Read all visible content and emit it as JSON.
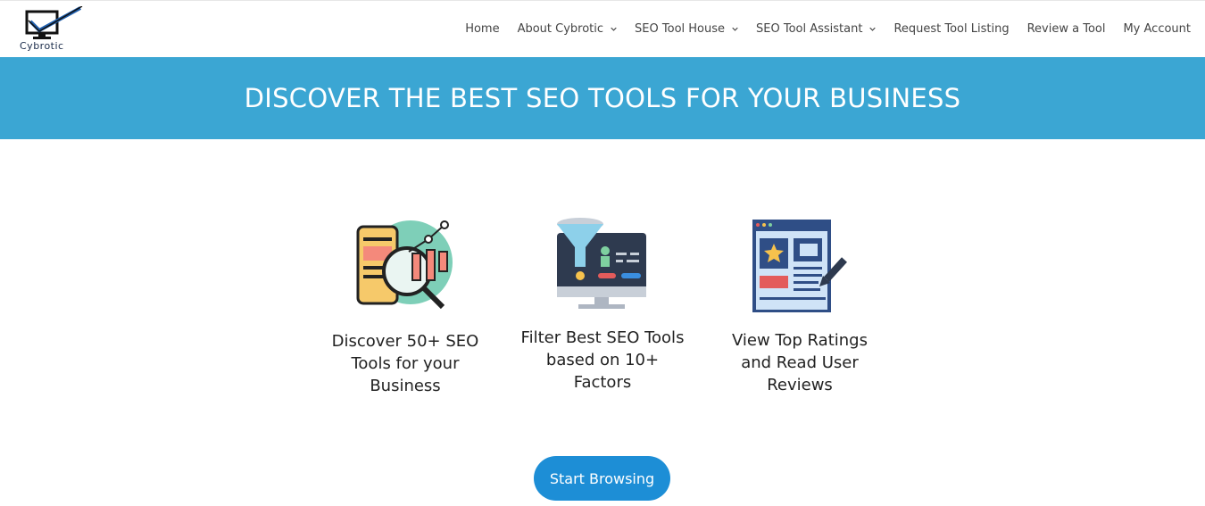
{
  "brand": {
    "logo_text": "Cybrotic"
  },
  "nav": {
    "items": [
      {
        "label": "Home",
        "has_dropdown": false
      },
      {
        "label": "About Cybrotic",
        "has_dropdown": true
      },
      {
        "label": "SEO Tool House",
        "has_dropdown": true
      },
      {
        "label": "SEO Tool Assistant",
        "has_dropdown": true
      },
      {
        "label": "Request Tool Listing",
        "has_dropdown": false
      },
      {
        "label": "Review a Tool",
        "has_dropdown": false
      },
      {
        "label": "My Account",
        "has_dropdown": false
      }
    ]
  },
  "banner": {
    "title": "DISCOVER THE BEST SEO TOOLS FOR YOUR BUSINESS",
    "color": "#3ba6d3"
  },
  "features": [
    {
      "icon": "analytics-magnifier-icon",
      "text": "Discover 50+ SEO Tools for your Business"
    },
    {
      "icon": "funnel-monitor-icon",
      "text": "Filter Best SEO Tools based on 10+ Factors"
    },
    {
      "icon": "review-document-pen-icon",
      "text": "View Top Ratings and Read User Reviews"
    }
  ],
  "cta": {
    "label": "Start Browsing",
    "color": "#1d8ed6"
  }
}
